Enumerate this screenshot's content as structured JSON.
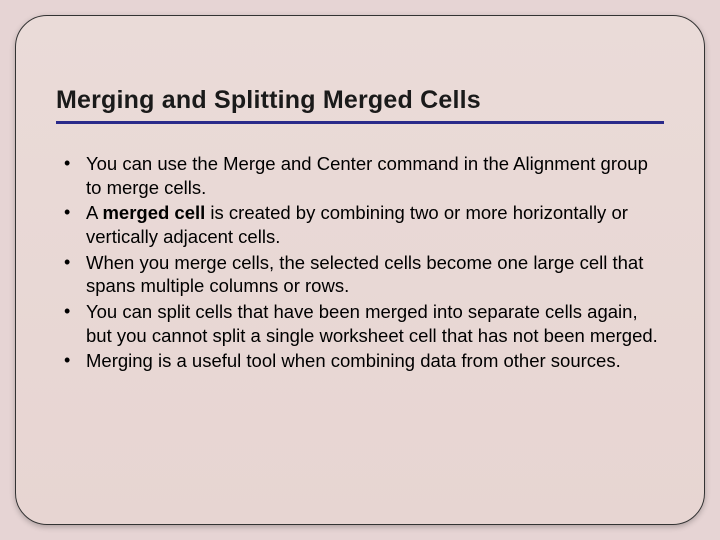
{
  "slide": {
    "title": "Merging and Splitting Merged Cells",
    "bullets": [
      {
        "pre": "You can use the Merge and Center command in the Alignment group to merge cells.",
        "bold": "",
        "post": ""
      },
      {
        "pre": "A ",
        "bold": "merged cell",
        "post": " is created by combining two or more horizontally or vertically adjacent cells."
      },
      {
        "pre": "When you merge cells, the selected cells become one large cell that spans multiple columns or rows.",
        "bold": "",
        "post": ""
      },
      {
        "pre": "You can split cells that have been merged into separate cells again, but you cannot split a single worksheet cell that has not been merged.",
        "bold": "",
        "post": ""
      },
      {
        "pre": "Merging is a useful tool when combining data from other sources.",
        "bold": "",
        "post": ""
      }
    ]
  }
}
